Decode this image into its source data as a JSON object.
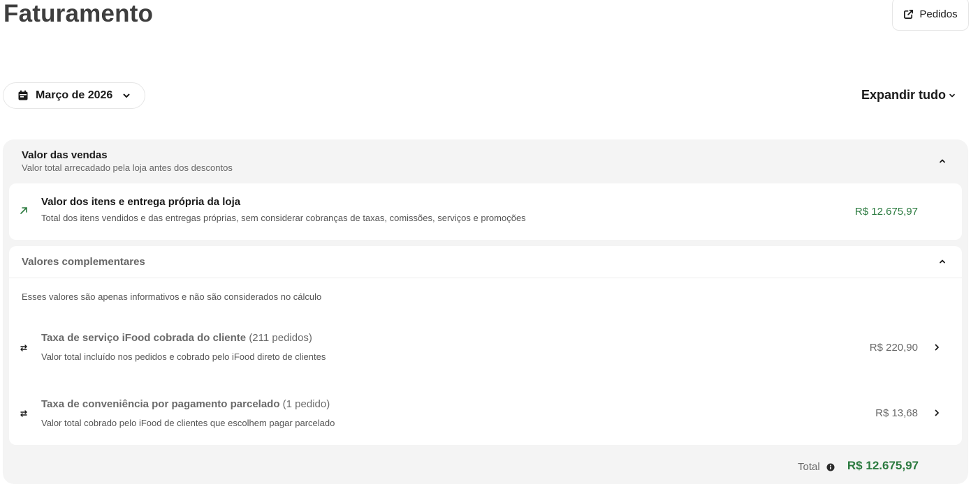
{
  "page": {
    "title": "Faturamento"
  },
  "header": {
    "orders_label": "Pedidos"
  },
  "filters": {
    "month_label": "Março de 2026",
    "expand_all_label": "Expandir tudo"
  },
  "sales_section": {
    "title": "Valor das vendas",
    "subtitle": "Valor total arrecadado pela loja antes dos descontos",
    "item": {
      "title": "Valor dos itens e entrega própria da loja",
      "description": "Total dos itens vendidos e das entregas próprias, sem considerar cobranças de taxas, comissões, serviços e promoções",
      "value": "R$ 12.675,97"
    }
  },
  "complementary_section": {
    "title": "Valores complementares",
    "note": "Esses valores são apenas informativos e não são considerados no cálculo",
    "rows": [
      {
        "title": "Taxa de serviço iFood cobrada do cliente",
        "count": "(211 pedidos)",
        "description": "Valor total incluído nos pedidos e cobrado pelo iFood direto de clientes",
        "value": "R$ 220,90"
      },
      {
        "title": "Taxa de conveniência por pagamento parcelado",
        "count": "(1 pedido)",
        "description": "Valor total cobrado pelo iFood de clientes que escolhem pagar parcelado",
        "value": "R$ 13,68"
      }
    ]
  },
  "total": {
    "label": "Total",
    "value": "R$ 12.675,97"
  },
  "colors": {
    "positive": "#2b7a3f",
    "panel_bg": "#f4f4f4",
    "text": "#3e3e3e"
  }
}
